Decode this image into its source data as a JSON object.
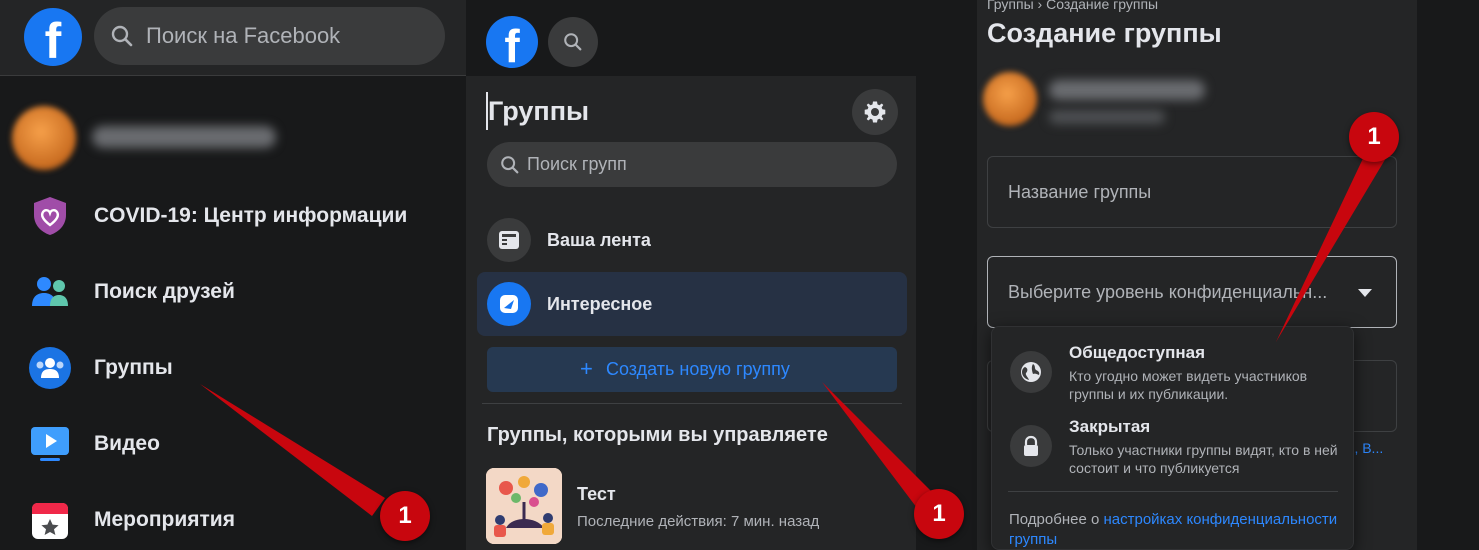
{
  "panel_a": {
    "search_placeholder": "Поиск на Facebook",
    "menu": [
      {
        "label": "COVID-19: Центр информации",
        "icon": "covid-shield-icon"
      },
      {
        "label": "Поиск друзей",
        "icon": "friends-icon"
      },
      {
        "label": "Группы",
        "icon": "groups-icon"
      },
      {
        "label": "Видео",
        "icon": "video-icon"
      },
      {
        "label": "Мероприятия",
        "icon": "events-icon"
      }
    ]
  },
  "panel_b": {
    "title": "Группы",
    "search_placeholder": "Поиск групп",
    "nav": [
      {
        "label": "Ваша лента",
        "icon": "feed-icon"
      },
      {
        "label": "Интересное",
        "icon": "discover-icon",
        "active": true
      }
    ],
    "create_button": {
      "plus": "+",
      "label": "Создать новую группу"
    },
    "section_title": "Группы, которыми вы управляете",
    "managed_group": {
      "name": "Тест",
      "meta": "Последние действия: 7 мин. назад"
    }
  },
  "panel_c": {
    "breadcrumb": "Группы › Создание группы",
    "title": "Создание группы",
    "name_placeholder": "Название группы",
    "privacy_placeholder": "Выберите уровень конфиденциальн...",
    "ghost_link": "в, В...",
    "options": [
      {
        "title": "Общедоступная",
        "desc": "Кто угодно может видеть участников группы и их публикации.",
        "icon": "globe-icon"
      },
      {
        "title": "Закрытая",
        "desc": "Только участники группы видят, кто в ней состоит и что публикуется",
        "icon": "lock-icon"
      }
    ],
    "footer_prefix": "Подробнее о",
    "footer_link": "настройках конфиденциальности группы"
  },
  "annotations": {
    "badges": [
      "1",
      "1",
      "1"
    ],
    "color": "#c8060e"
  },
  "colors": {
    "background": "#18191a",
    "surface": "#242526",
    "accent": "#2d88ff",
    "brand": "#1877f2"
  }
}
